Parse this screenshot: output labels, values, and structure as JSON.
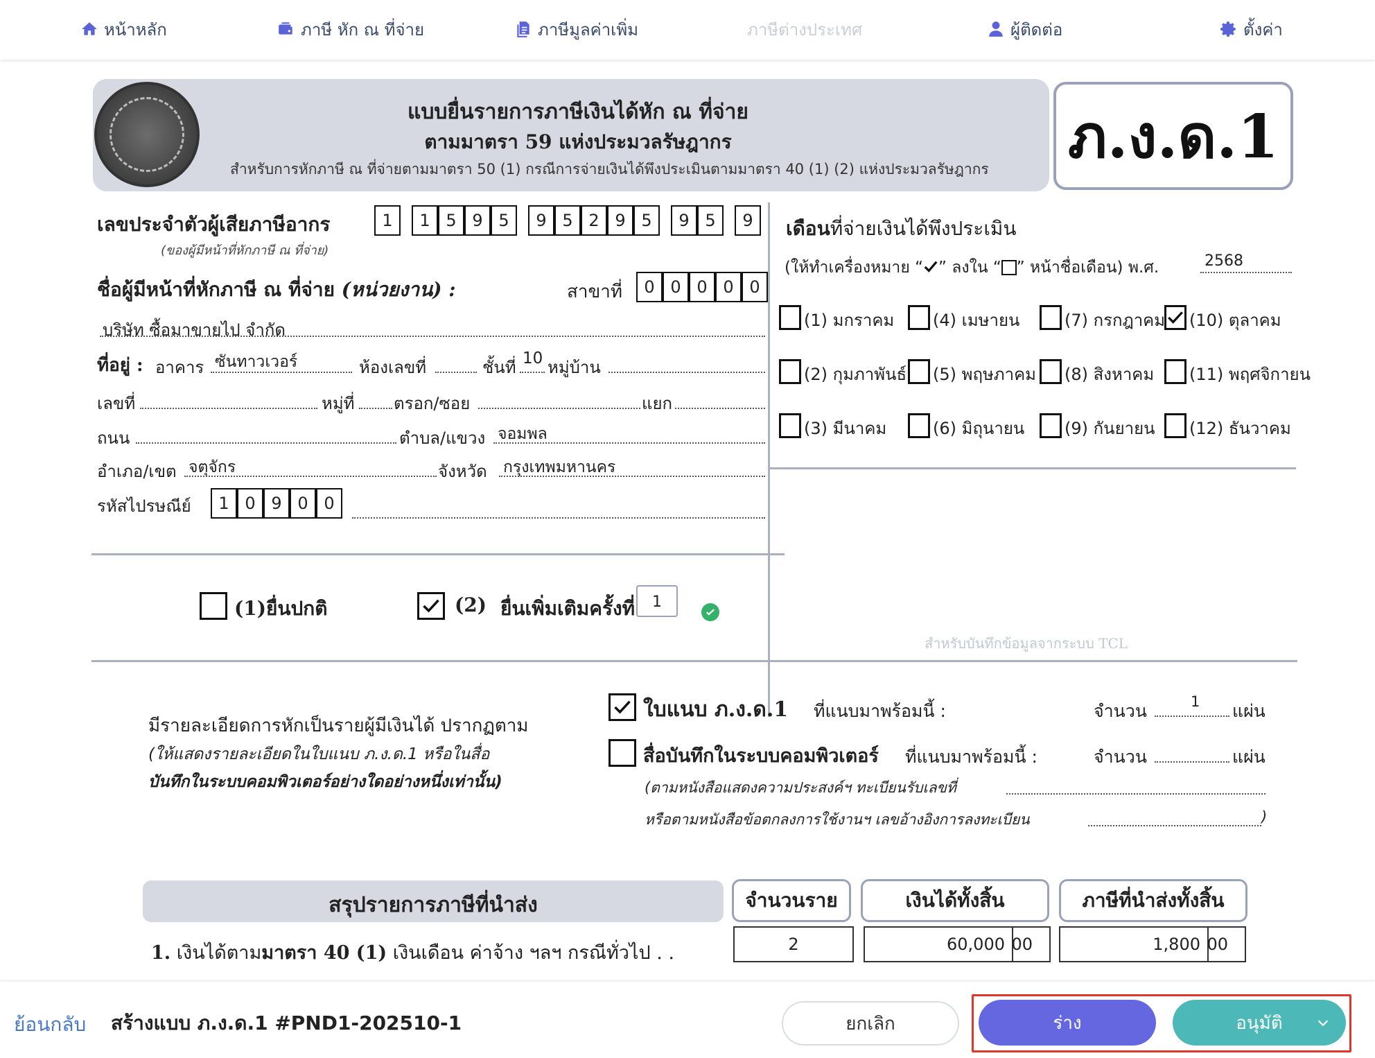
{
  "nav": {
    "items": [
      {
        "label": "หน้าหลัก",
        "icon": "home-icon"
      },
      {
        "label": "ภาษี หัก ณ ที่จ่าย",
        "icon": "wallet-icon"
      },
      {
        "label": "ภาษีมูลค่าเพิ่ม",
        "icon": "document-icon"
      },
      {
        "label": "ภาษีต่างประเทศ",
        "icon": "",
        "disabled": true
      },
      {
        "label": "ผู้ติดต่อ",
        "icon": "user-icon"
      },
      {
        "label": "ตั้งค่า",
        "icon": "gear-icon"
      }
    ]
  },
  "form": {
    "header": {
      "title": "แบบยื่นรายการภาษีเงินได้หัก ณ ที่จ่าย",
      "subtitle": "ตามมาตรา 59 แห่งประมวลรัษฎากร",
      "description": "สำหรับการหักภาษี ณ ที่จ่ายตามมาตรา 50 (1) กรณีการจ่ายเงินได้พึงประเมินตามมาตรา 40 (1) (2) แห่งประมวลรัษฎากร",
      "form_code": "ภ.ง.ด.1"
    },
    "tax_id": {
      "label": "เลขประจำตัวผู้เสียภาษีอากร",
      "sublabel": "(ของผู้มีหน้าที่หักภาษี ณ ที่จ่าย)",
      "digits": [
        "1",
        "1",
        "5",
        "9",
        "5",
        "9",
        "5",
        "2",
        "9",
        "5",
        "9",
        "5",
        "9"
      ]
    },
    "payer": {
      "label": "ชื่อผู้มีหน้าที่หักภาษี ณ ที่จ่าย",
      "label_suffix": "(หน่วยงาน) :",
      "branch_label": "สาขาที่",
      "branch_digits": [
        "0",
        "0",
        "0",
        "0",
        "0"
      ],
      "name": "บริษัท ซื้อมาขายไป จำกัด"
    },
    "address": {
      "label": "ที่อยู่ :",
      "building_label": "อาคาร",
      "building": "ซันทาวเวอร์",
      "room_label": "ห้องเลขที่",
      "floor_label": "ชั้นที่",
      "floor": "10",
      "village_label": "หมู่บ้าน",
      "no_label": "เลขที่",
      "moo_label": "หมู่ที่",
      "soi_label": "ตรอก/ซอย",
      "junction_label": "แยก",
      "road_label": "ถนน",
      "subdistrict_label": "ตำบล/แขวง",
      "subdistrict": "จอมพล",
      "district_label": "อำเภอ/เขต",
      "district": "จตุจักร",
      "province_label": "จังหวัด",
      "province": "กรุงเทพมหานคร",
      "postal_label": "รหัสไปรษณีย์",
      "postal_digits": [
        "1",
        "0",
        "9",
        "0",
        "0"
      ]
    },
    "filing": {
      "normal_label": "(1)ยื่นปกติ",
      "normal_checked": false,
      "additional_num": "(2)",
      "additional_label": "ยื่นเพิ่มเติมครั้งที่",
      "additional_checked": true,
      "additional_count": "1"
    },
    "months": {
      "title_bold": "เดือน",
      "title_rest": "ที่จ่ายเงินได้พึงประเมิน",
      "instruction_a": "(ให้ทำเครื่องหมาย “",
      "instruction_b": "” ลงใน “",
      "instruction_c": "” หน้าชื่อเดือน) พ.ศ.",
      "year": "2568",
      "list": [
        {
          "label": "(1) มกราคม",
          "checked": false
        },
        {
          "label": "(4) เมษายน",
          "checked": false
        },
        {
          "label": "(7) กรกฎาคม",
          "checked": false
        },
        {
          "label": "(10) ตุลาคม",
          "checked": true
        },
        {
          "label": "(2) กุมภาพันธ์",
          "checked": false
        },
        {
          "label": "(5) พฤษภาคม",
          "checked": false
        },
        {
          "label": "(8) สิงหาคม",
          "checked": false
        },
        {
          "label": "(11) พฤศจิกายน",
          "checked": false
        },
        {
          "label": "(3) มีนาคม",
          "checked": false
        },
        {
          "label": "(6) มิถุนายน",
          "checked": false
        },
        {
          "label": "(9) กันยายน",
          "checked": false
        },
        {
          "label": "(12) ธันวาคม",
          "checked": false
        }
      ],
      "tcl_note": "สำหรับบันทึกข้อมูลจากระบบ TCL"
    },
    "attachments": {
      "intro_1": "มีรายละเอียดการหักเป็นรายผู้มีเงินได้ ปรากฏตาม",
      "intro_2": "(ให้แสดงรายละเอียดในใบแนบ ภ.ง.ด.1 หรือในสื่อ",
      "intro_3": "บันทึกในระบบคอมพิวเตอร์อย่างใดอย่างหนึ่งเท่านั้น)",
      "attach_label": "ใบแนบ ภ.ง.ด.1",
      "attach_suffix": "ที่แนบมาพร้อมนี้ :",
      "attach_checked": true,
      "count_label": "จำนวน",
      "sheet_unit": "แผ่น",
      "attach_count": "1",
      "media_label": "สื่อบันทึกในระบบคอมพิวเตอร์",
      "media_suffix": "ที่แนบมาพร้อมนี้ :",
      "media_checked": false,
      "media_note_1": "(ตามหนังสือแสดงความประสงค์ฯ ทะเบียนรับเลขที่",
      "media_note_2": "หรือตามหนังสือข้อตกลงการใช้งานฯ เลขอ้างอิงการลงทะเบียน",
      "media_note_end": ")"
    },
    "summary": {
      "title": "สรุปรายการภาษีที่นำส่ง",
      "col_count": "จำนวนราย",
      "col_income": "เงินได้ทั้งสิ้น",
      "col_tax": "ภาษีที่นำส่งทั้งสิ้น",
      "row1_num": "1.",
      "row1_a": "เงินได้ตาม",
      "row1_b": "มาตรา 40 (1)",
      "row1_c": "เงินเดือน ค่าจ้าง ฯลฯ กรณีทั่วไป",
      "row1_dots": ". .",
      "row1_count": "2",
      "row1_income_baht": "60,000",
      "row1_income_satang": "00",
      "row1_tax_baht": "1,800",
      "row1_tax_satang": "00"
    }
  },
  "footer": {
    "back_label": "ย้อนกลับ",
    "title": "สร้างแบบ ภ.ง.ด.1 #PND1-202510-1",
    "cancel_label": "ยกเลิก",
    "draft_label": "ร่าง",
    "approve_label": "อนุมัติ"
  },
  "colors": {
    "accent": "#6567e0",
    "approve": "#4db8b8",
    "link": "#4a78c9",
    "focus": "#e0372b",
    "band": "#d7d9e2"
  }
}
